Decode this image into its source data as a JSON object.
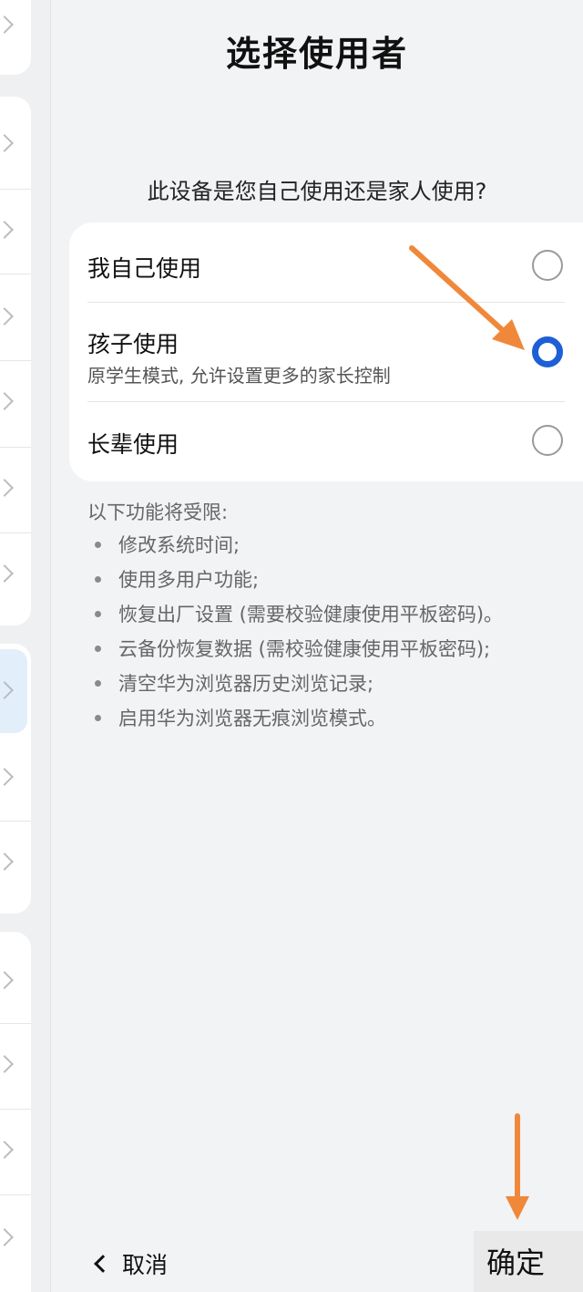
{
  "dialog": {
    "title": "选择使用者",
    "question": "此设备是您自己使用还是家人使用?"
  },
  "options": [
    {
      "label": "我自己使用",
      "description": "",
      "selected": false
    },
    {
      "label": "孩子使用",
      "description": "原学生模式, 允许设置更多的家长控制",
      "selected": true
    },
    {
      "label": "长辈使用",
      "description": "",
      "selected": false
    }
  ],
  "restrictions": {
    "title": "以下功能将受限:",
    "items": [
      "修改系统时间;",
      "使用多用户功能;",
      "恢复出厂设置 (需要校验健康使用平板密码)。",
      "云备份恢复数据 (需校验健康使用平板密码);",
      "清空华为浏览器历史浏览记录;",
      "启用华为浏览器无痕浏览模式。"
    ]
  },
  "footer": {
    "cancel_label": "取消",
    "confirm_label": "确定"
  },
  "colors": {
    "accent": "#1f5fd6",
    "annotation_arrow": "#f0883a",
    "background": "#f1f3f5"
  }
}
